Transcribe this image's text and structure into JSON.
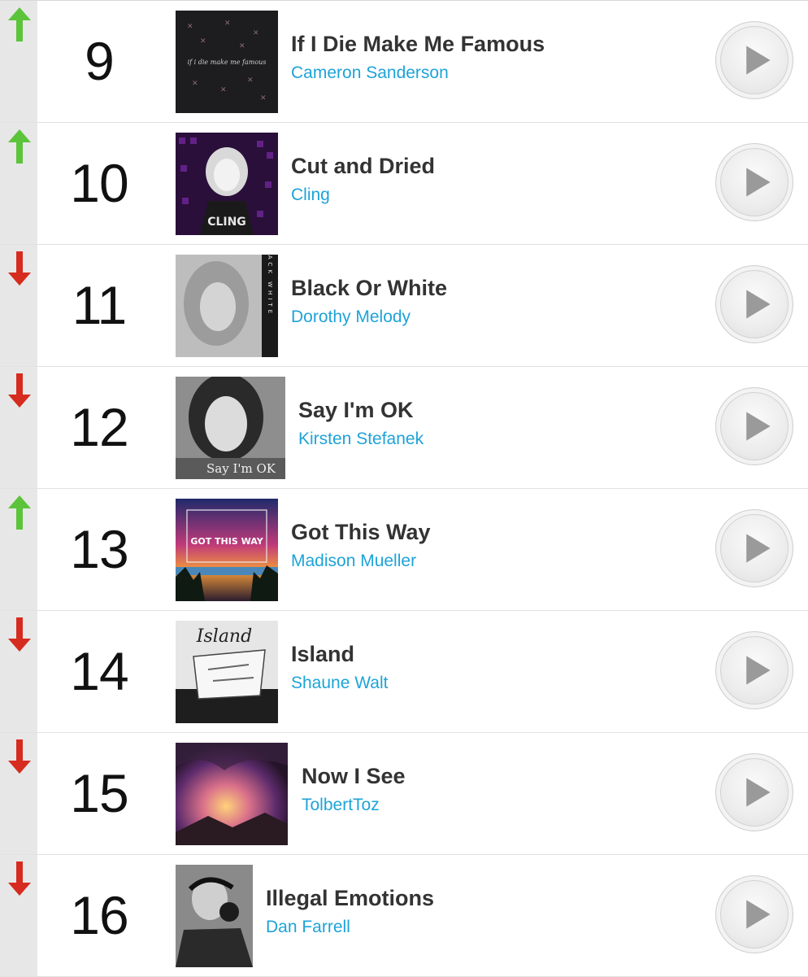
{
  "chart": {
    "entries": [
      {
        "rank": "9",
        "title": "If I Die Make Me Famous",
        "artist": "Cameron Sanderson",
        "trend": "up",
        "art_caption": "if i die make me famous"
      },
      {
        "rank": "10",
        "title": "Cut and Dried",
        "artist": "Cling",
        "trend": "up",
        "art_caption": "CLING"
      },
      {
        "rank": "11",
        "title": "Black Or White",
        "artist": "Dorothy Melody",
        "trend": "down",
        "art_caption": "BLACK WHITE"
      },
      {
        "rank": "12",
        "title": "Say I'm OK",
        "artist": "Kirsten Stefanek",
        "trend": "down",
        "art_caption": "Say I'm OK"
      },
      {
        "rank": "13",
        "title": "Got This Way",
        "artist": "Madison Mueller",
        "trend": "up",
        "art_caption": "GOT THIS WAY"
      },
      {
        "rank": "14",
        "title": "Island",
        "artist": "Shaune Walt",
        "trend": "down",
        "art_caption": "Island"
      },
      {
        "rank": "15",
        "title": "Now I See",
        "artist": "TolbertToz",
        "trend": "down",
        "art_caption": ""
      },
      {
        "rank": "16",
        "title": "Illegal Emotions",
        "artist": "Dan Farrell",
        "trend": "down",
        "art_caption": ""
      }
    ]
  },
  "icons": {
    "up": "arrow-up-icon",
    "down": "arrow-down-icon",
    "play": "play-icon"
  },
  "colors": {
    "up": "#5cc43a",
    "down": "#d62b1f",
    "artist": "#1ea3d8",
    "title": "#333333",
    "trend_bg": "#e7e7e7"
  }
}
